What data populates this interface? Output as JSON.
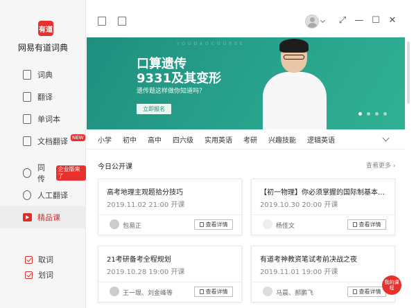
{
  "app": {
    "logo_text": "有道",
    "name": "网易有道词典"
  },
  "sidebar": {
    "items": [
      {
        "label": "词典",
        "icon": "dictionary-icon"
      },
      {
        "label": "翻译",
        "icon": "translate-icon"
      },
      {
        "label": "单词本",
        "icon": "wordbook-icon"
      },
      {
        "label": "文档翻译",
        "icon": "document-icon",
        "badge": "NEW"
      },
      {
        "label": "同传",
        "icon": "cloud-icon",
        "badge": "企业版来了"
      },
      {
        "label": "人工翻译",
        "icon": "human-translate-icon"
      },
      {
        "label": "精品课",
        "icon": "video-course-icon",
        "active": true
      }
    ],
    "checks": [
      {
        "label": "取词",
        "checked": true
      },
      {
        "label": "划词",
        "checked": true
      }
    ]
  },
  "banner": {
    "ghost_text": "YOUDAOCOURSE",
    "title_line1": "口算遗传",
    "title_line2": "9331及其变形",
    "subtitle": "遗传题这样做你知道吗？",
    "cta": "立即报名",
    "slide_count": 4,
    "active_slide": 1
  },
  "tabs": [
    "小学",
    "初中",
    "高中",
    "四六级",
    "实用英语",
    "考研",
    "兴趣技能",
    "逻辑英语"
  ],
  "section": {
    "title": "今日公开课",
    "more": "查看更多 ›"
  },
  "cards": [
    {
      "title": "高考地理主观题拾分技巧",
      "date": "2019.11.02 21:00 开课",
      "teacher": "包易正",
      "button": "查看详情"
    },
    {
      "title": "【初一物理】你必须掌握的国际制基本单位",
      "date": "2019.10.30 20:00 开课",
      "teacher": "杨佳文",
      "button": "查看详情"
    },
    {
      "title": "21考研备考全程规划",
      "date": "2019.10.28 19:00 开课",
      "teacher": "王一琨、刘金峰等",
      "button": "查看详情"
    },
    {
      "title": "有道考神教资笔试考前决战之夜",
      "date": "2019.11.01 19:00 开课",
      "teacher": "马晨、郝鹏飞",
      "button": "查看详情"
    }
  ],
  "float_button": "我的课程",
  "colors": {
    "accent": "#e8312f",
    "banner": "#27a18b"
  }
}
